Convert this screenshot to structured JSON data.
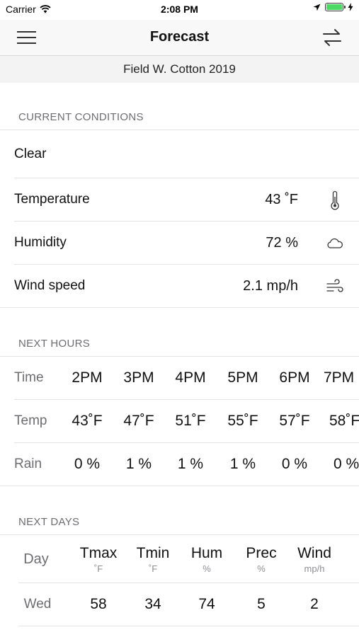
{
  "status_bar": {
    "carrier": "Carrier",
    "time": "2:08 PM"
  },
  "nav": {
    "title": "Forecast"
  },
  "subheader": "Field W. Cotton 2019",
  "current": {
    "header": "CURRENT CONDITIONS",
    "summary": "Clear",
    "rows": [
      {
        "label": "Temperature",
        "value": "43 ˚F",
        "icon": "thermometer-icon"
      },
      {
        "label": "Humidity",
        "value": "72 %",
        "icon": "cloud-icon"
      },
      {
        "label": "Wind speed",
        "value": "2.1 mp/h",
        "icon": "wind-icon"
      }
    ]
  },
  "hours": {
    "header": "NEXT HOURS",
    "labels": {
      "time": "Time",
      "temp": "Temp",
      "rain": "Rain"
    },
    "time": [
      "2PM",
      "3PM",
      "4PM",
      "5PM",
      "6PM",
      "7PM"
    ],
    "temp": [
      "43˚F",
      "47˚F",
      "51˚F",
      "55˚F",
      "57˚F",
      "58˚F"
    ],
    "rain": [
      "0 %",
      "1 %",
      "1 %",
      "1 %",
      "0 %",
      "0 %"
    ]
  },
  "days": {
    "header": "NEXT DAYS",
    "columns": [
      {
        "title": "Day",
        "unit": ""
      },
      {
        "title": "Tmax",
        "unit": "˚F"
      },
      {
        "title": "Tmin",
        "unit": "˚F"
      },
      {
        "title": "Hum",
        "unit": "%"
      },
      {
        "title": "Prec",
        "unit": "%"
      },
      {
        "title": "Wind",
        "unit": "mp/h"
      }
    ],
    "rows": [
      {
        "day": "Wed",
        "tmax": "58",
        "tmin": "34",
        "hum": "74",
        "prec": "5",
        "wind": "2"
      }
    ]
  },
  "colors": {
    "battery": "#4cd964",
    "secondary_text": "#6d6d72",
    "nav_bg": "#f8f8f8"
  }
}
